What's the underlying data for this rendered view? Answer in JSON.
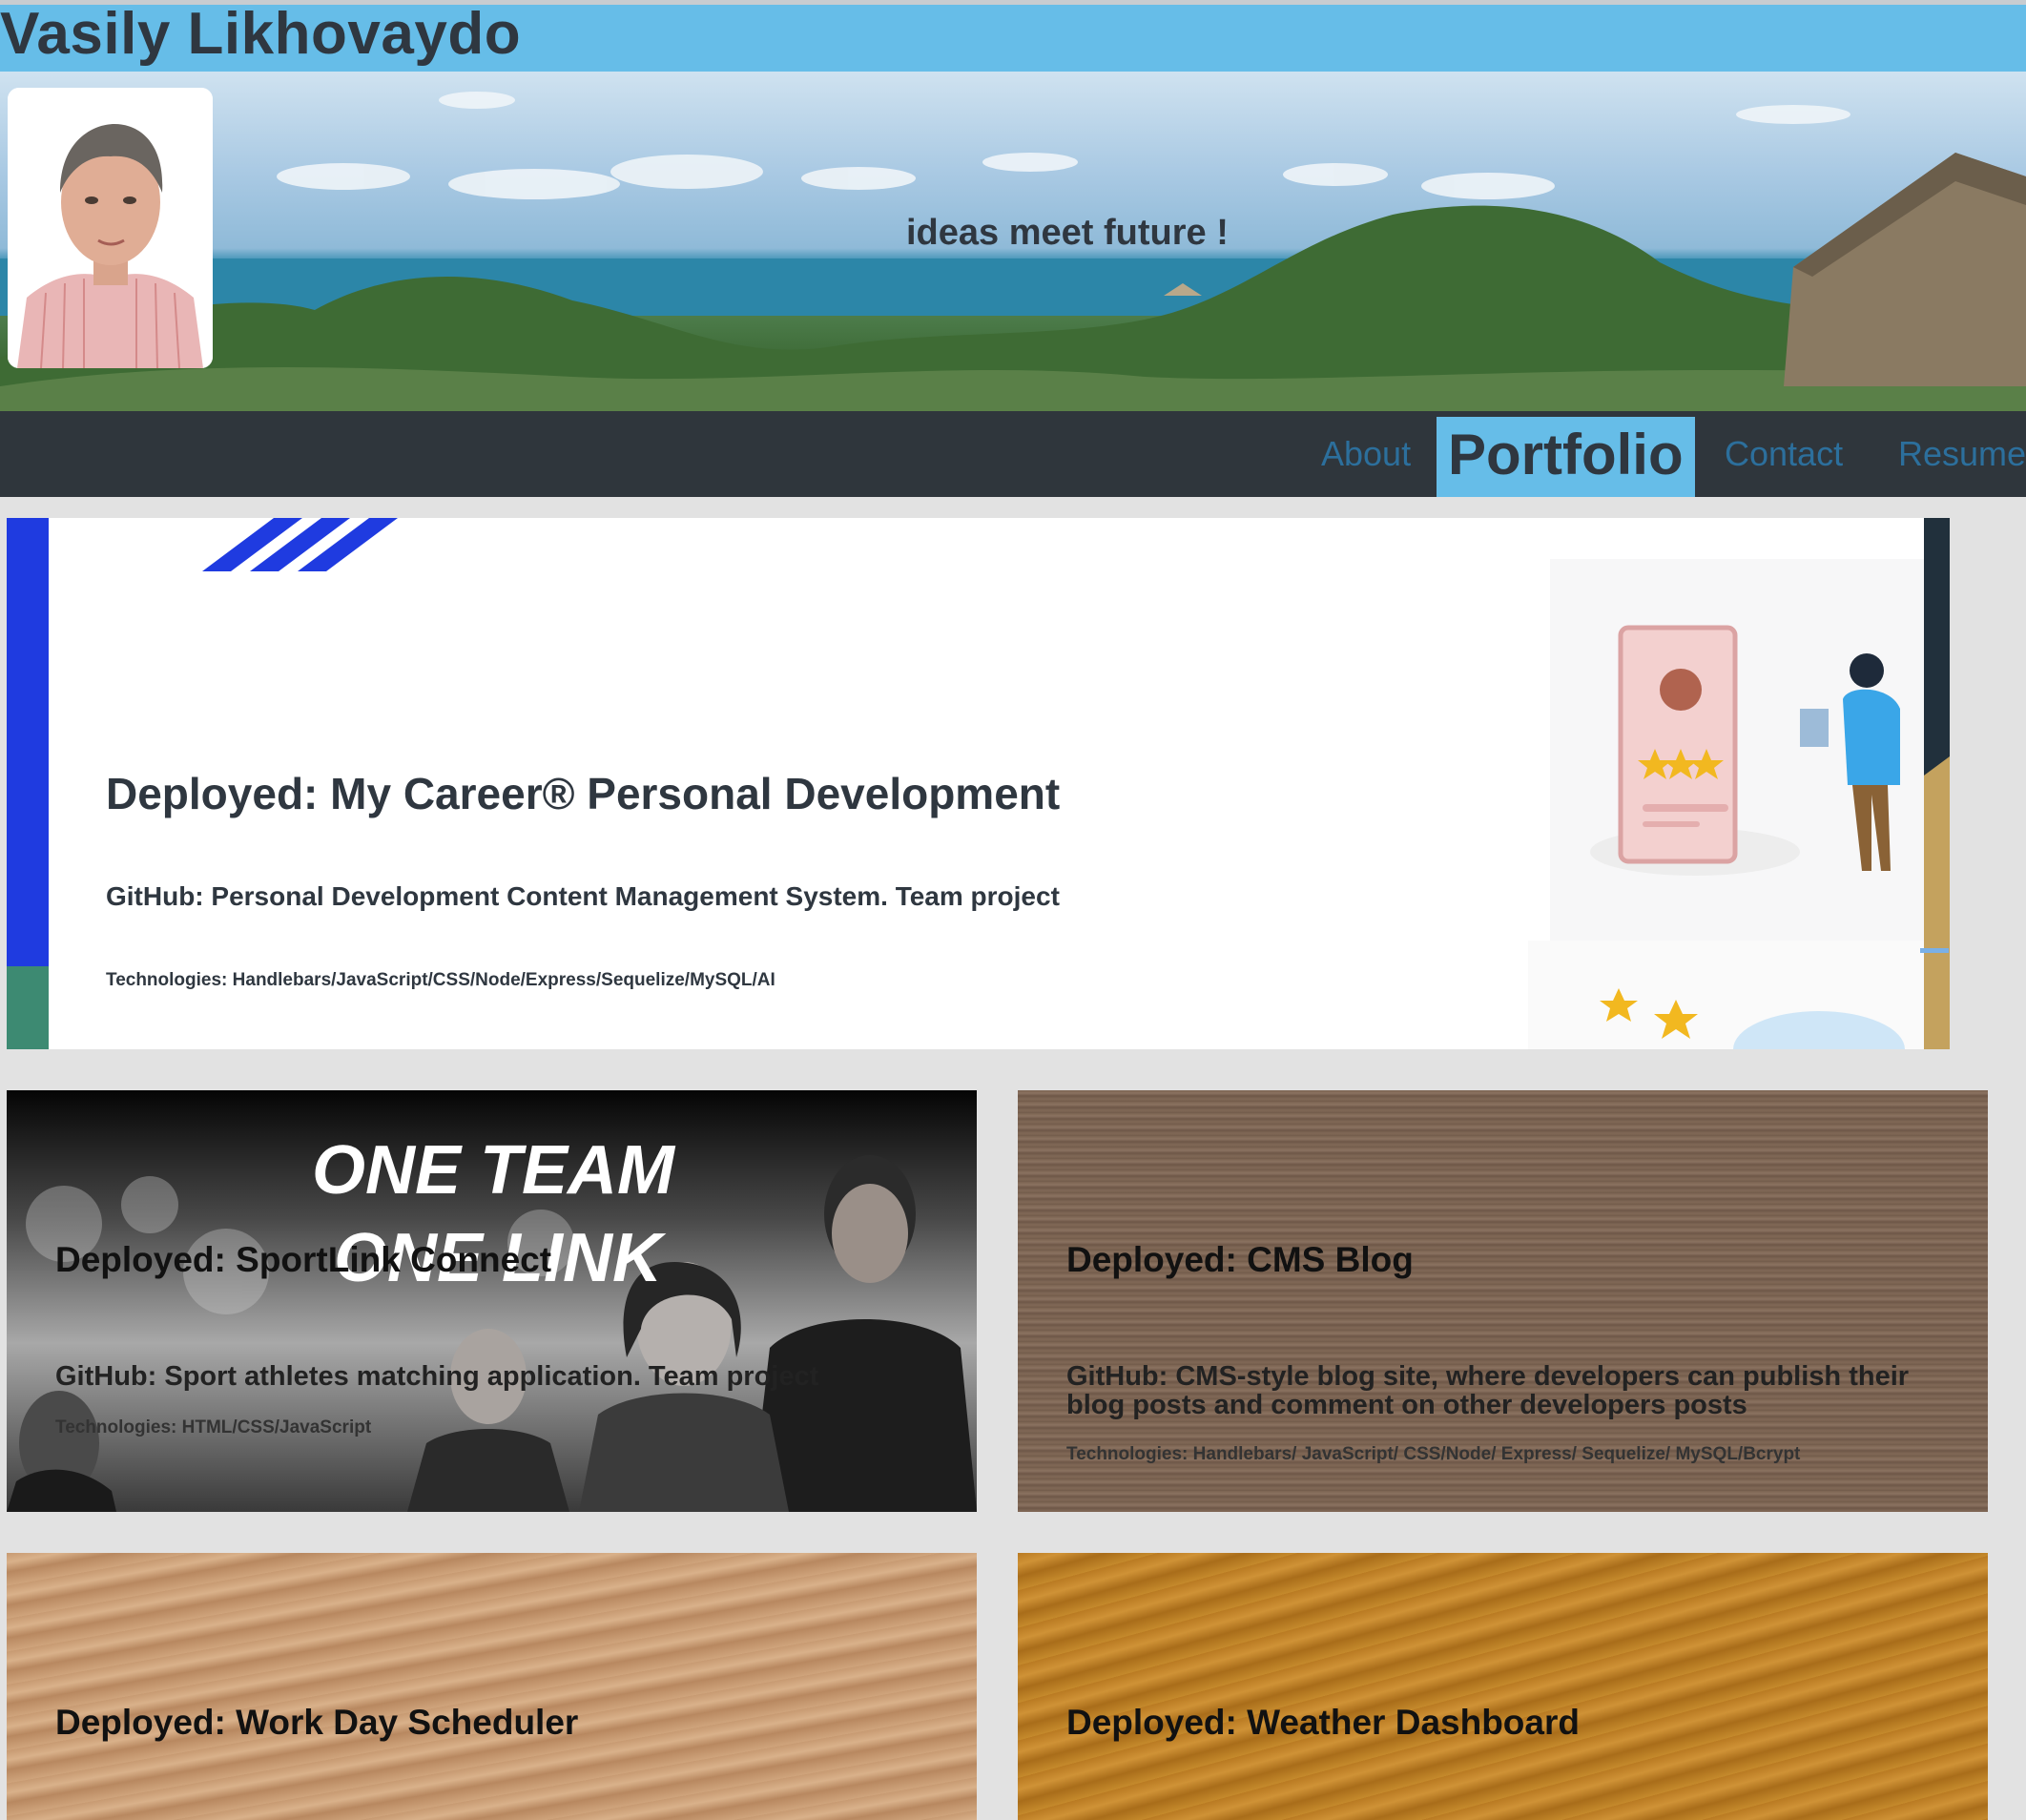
{
  "header": {
    "name": "Vasily Likhovaydo",
    "tagline": "ideas meet future !"
  },
  "nav": {
    "items": [
      {
        "label": "About",
        "active": false
      },
      {
        "label": "Portfolio",
        "active": true
      },
      {
        "label": "Contact",
        "active": false
      },
      {
        "label": "Resume",
        "active": false
      }
    ]
  },
  "projects": [
    {
      "title": "Deployed: My Career® Personal Development",
      "github": "GitHub: Personal Development Content Management System. Team project",
      "tech": "Technologies: Handlebars/JavaScript/CSS/Node/Express/Sequelize/MySQL/AI"
    },
    {
      "title": "Deployed: SportLink Connect",
      "github": "GitHub: Sport athletes matching application. Team project",
      "tech": "Technologies: HTML/CSS/JavaScript",
      "overlay_line1": "ONE TEAM",
      "overlay_line2": "ONE LINK"
    },
    {
      "title": "Deployed: CMS Blog",
      "github": "GitHub: CMS-style blog site, where developers can publish their blog posts and comment on other developers posts",
      "tech": "Technologies: Handlebars/ JavaScript/ CSS/Node/ Express/ Sequelize/ MySQL/Bcrypt"
    },
    {
      "title": "Deployed: Work Day Scheduler"
    },
    {
      "title": "Deployed: Weather Dashboard"
    }
  ],
  "colors": {
    "header_blue": "#66bde8",
    "nav_dark": "#2f363c",
    "link_blue": "#2c6f9c",
    "page_bg": "#e2e2e2"
  }
}
